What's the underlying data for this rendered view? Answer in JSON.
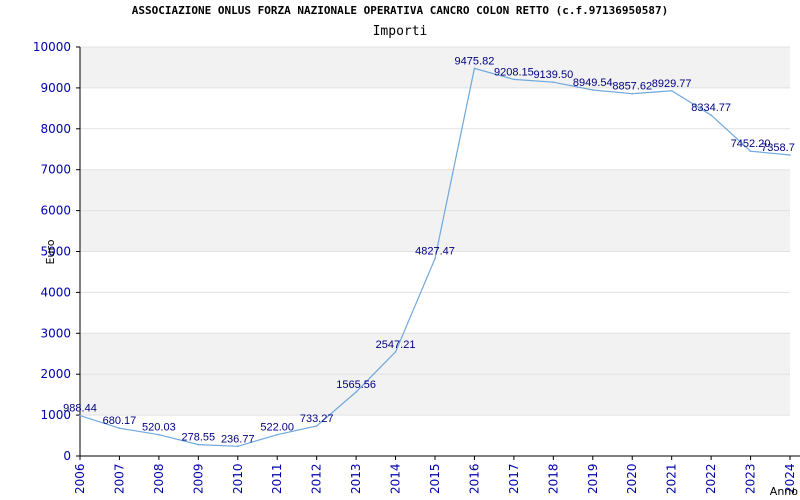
{
  "header": {
    "title": "ASSOCIAZIONE ONLUS FORZA NAZIONALE OPERATIVA CANCRO COLON RETTO (c.f.97136950587)",
    "subtitle": "Importi"
  },
  "chart_data": {
    "type": "line",
    "title": "ASSOCIAZIONE ONLUS FORZA NAZIONALE OPERATIVA CANCRO COLON RETTO (c.f.97136950587)",
    "subtitle": "Importi",
    "xlabel": "Anno",
    "ylabel": "Euro",
    "ylim": [
      0,
      10000
    ],
    "yticks": [
      0,
      1000,
      2000,
      3000,
      4000,
      5000,
      6000,
      7000,
      8000,
      9000,
      10000
    ],
    "grid": true,
    "colors": {
      "line": "#6fa8dc",
      "band": "#f2f2f2",
      "tick_text": "#0000aa",
      "label_text": "#000080"
    },
    "x": [
      "2006",
      "2007",
      "2008",
      "2009",
      "2010",
      "2011",
      "2012",
      "2013",
      "2014",
      "2015",
      "2016",
      "2017",
      "2018",
      "2019",
      "2020",
      "2021",
      "2022",
      "2023",
      "2024"
    ],
    "series": [
      {
        "values": [
          988.44,
          680.17,
          520.03,
          278.55,
          236.77,
          522.0,
          733.27,
          1565.56,
          2547.21,
          4827.47,
          9475.82,
          9208.15,
          9139.5,
          8949.54,
          8857.62,
          8929.77,
          8334.77,
          7452.2,
          7358.7
        ],
        "labels": [
          "988.44",
          "680.17",
          "520.03",
          "278.55",
          "236.77",
          "522.00",
          "733.27",
          "1565.56",
          "2547.21",
          "4827.47",
          "9475.82",
          "9208.15",
          "9139.50",
          "8949.54",
          "8857.62",
          "8929.77",
          "8334.77",
          "7452.20",
          "7358.7"
        ]
      }
    ]
  }
}
